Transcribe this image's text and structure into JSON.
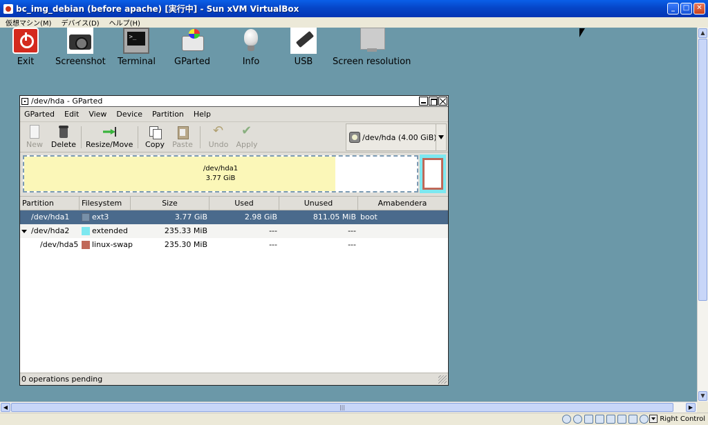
{
  "vbox": {
    "title": "bc_img_debian (before apache) [実行中] - Sun xVM VirtualBox",
    "menu": [
      "仮想マシン(M)",
      "デバイス(D)",
      "ヘルプ(H)"
    ],
    "minimize": "_",
    "maximize": "□",
    "close": "✕",
    "host_key": "Right Control"
  },
  "launcher": {
    "items": [
      {
        "label": "Exit",
        "icon": "power-icon"
      },
      {
        "label": "Screenshot",
        "icon": "camera-icon"
      },
      {
        "label": "Terminal",
        "icon": "terminal-icon"
      },
      {
        "label": "GParted",
        "icon": "gparted-icon"
      },
      {
        "label": "Info",
        "icon": "lightbulb-icon"
      },
      {
        "label": "USB",
        "icon": "usb-icon"
      },
      {
        "label": "Screen resolution",
        "icon": "monitor-icon"
      }
    ]
  },
  "gparted": {
    "title": "/dev/hda - GParted",
    "menu": [
      "GParted",
      "Edit",
      "View",
      "Device",
      "Partition",
      "Help"
    ],
    "toolbar": {
      "new": "New",
      "delete": "Delete",
      "resize": "Resize/Move",
      "copy": "Copy",
      "paste": "Paste",
      "undo": "Undo",
      "apply": "Apply"
    },
    "device": "/dev/hda  (4.00 GiB)",
    "diskmap": {
      "name": "/dev/hda1",
      "size": "3.77 GiB"
    },
    "columns": [
      "Partition",
      "Filesystem",
      "Size",
      "Used",
      "Unused",
      "Amabendera"
    ],
    "rows": [
      {
        "partition": "/dev/hda1",
        "filesystem": "ext3",
        "size": "3.77 GiB",
        "used": "2.98 GiB",
        "unused": "811.05 MiB",
        "flags": "boot",
        "color": "#7890a8"
      },
      {
        "partition": "/dev/hda2",
        "filesystem": "extended",
        "size": "235.33 MiB",
        "used": "---",
        "unused": "---",
        "flags": "",
        "color": "#7de8f0"
      },
      {
        "partition": "/dev/hda5",
        "filesystem": "linux-swap",
        "size": "235.30 MiB",
        "used": "---",
        "unused": "---",
        "flags": "",
        "color": "#c06858"
      }
    ],
    "status": "0 operations pending"
  },
  "colors": {
    "desktop": "#6b98a8",
    "selection": "#4a6a8c",
    "used_space": "#fbf7b8"
  }
}
